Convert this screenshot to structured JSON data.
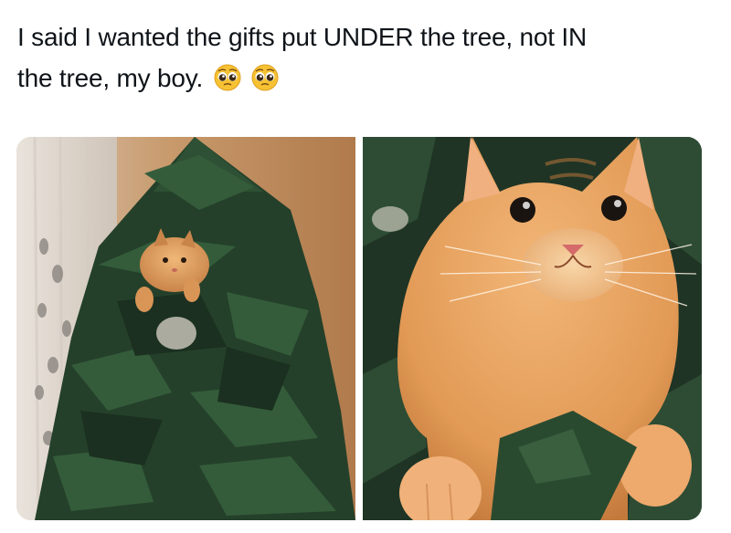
{
  "tweet": {
    "text_line1": "I said I wanted the gifts put UNDER the tree, not IN",
    "text_line2": "the tree, my boy.",
    "emojis": [
      "pleading-face-emoji",
      "pleading-face-emoji"
    ]
  },
  "media": {
    "photos": [
      {
        "subject": "cat-in-christmas-tree-wide"
      },
      {
        "subject": "cat-in-christmas-tree-closeup"
      }
    ]
  },
  "colors": {
    "text": "#0f1419",
    "tree_green": "#24402a",
    "cat_orange": "#e0a060",
    "wall": "#c89a6c"
  }
}
